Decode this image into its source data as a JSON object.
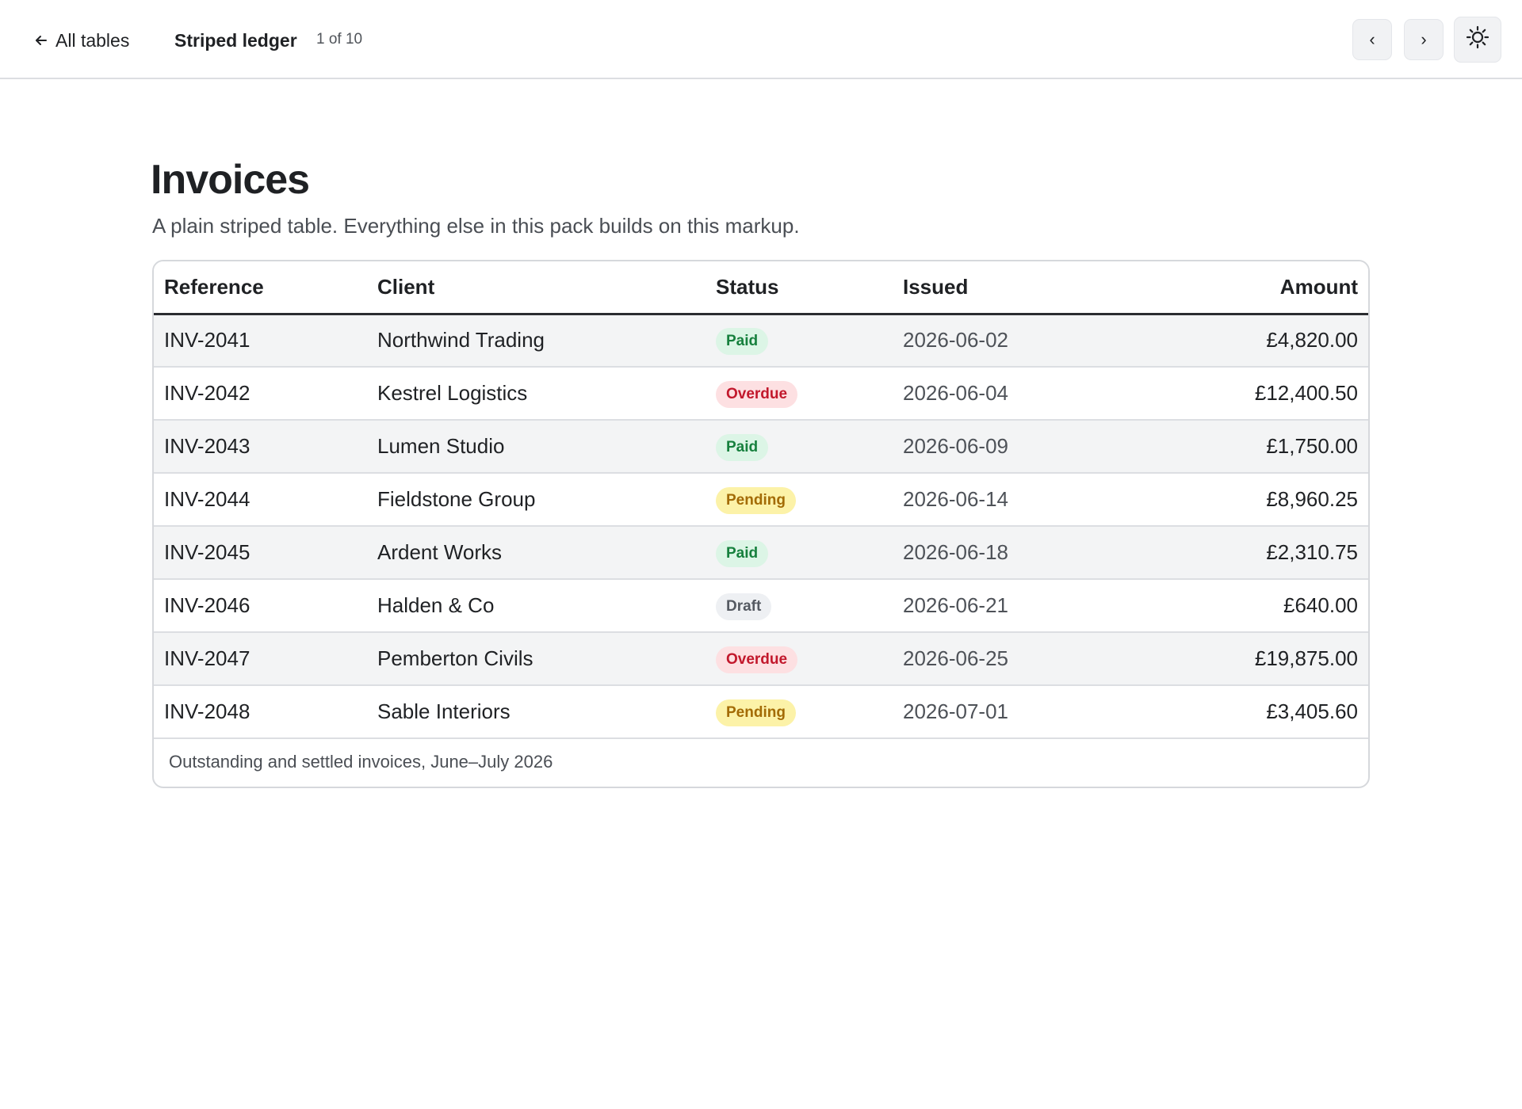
{
  "topbar": {
    "back_label": "All tables",
    "title": "Striped ledger",
    "position": "1 of 10",
    "prev_label": "‹",
    "next_label": "›"
  },
  "page": {
    "title": "Invoices",
    "subtitle": "A plain striped table. Everything else in this pack builds on this markup."
  },
  "table": {
    "headers": {
      "reference": "Reference",
      "client": "Client",
      "status": "Status",
      "issued": "Issued",
      "amount": "Amount"
    },
    "rows": [
      {
        "reference": "INV-2041",
        "client": "Northwind Trading",
        "status": "Paid",
        "status_kind": "paid",
        "issued": "2026-06-02",
        "amount": "£4,820.00"
      },
      {
        "reference": "INV-2042",
        "client": "Kestrel Logistics",
        "status": "Overdue",
        "status_kind": "overdue",
        "issued": "2026-06-04",
        "amount": "£12,400.50"
      },
      {
        "reference": "INV-2043",
        "client": "Lumen Studio",
        "status": "Paid",
        "status_kind": "paid",
        "issued": "2026-06-09",
        "amount": "£1,750.00"
      },
      {
        "reference": "INV-2044",
        "client": "Fieldstone Group",
        "status": "Pending",
        "status_kind": "pending",
        "issued": "2026-06-14",
        "amount": "£8,960.25"
      },
      {
        "reference": "INV-2045",
        "client": "Ardent Works",
        "status": "Paid",
        "status_kind": "paid",
        "issued": "2026-06-18",
        "amount": "£2,310.75"
      },
      {
        "reference": "INV-2046",
        "client": "Halden & Co",
        "status": "Draft",
        "status_kind": "draft",
        "issued": "2026-06-21",
        "amount": "£640.00"
      },
      {
        "reference": "INV-2047",
        "client": "Pemberton Civils",
        "status": "Overdue",
        "status_kind": "overdue",
        "issued": "2026-06-25",
        "amount": "£19,875.00"
      },
      {
        "reference": "INV-2048",
        "client": "Sable Interiors",
        "status": "Pending",
        "status_kind": "pending",
        "issued": "2026-07-01",
        "amount": "£3,405.60"
      }
    ],
    "caption": "Outstanding and settled invoices, June–July 2026"
  },
  "colors": {
    "paid": "#16803d",
    "overdue": "#c2182c",
    "pending": "#a36b05",
    "draft": "#555a62"
  },
  "icons": {
    "back": "arrow-left-icon",
    "theme": "sun-icon"
  }
}
